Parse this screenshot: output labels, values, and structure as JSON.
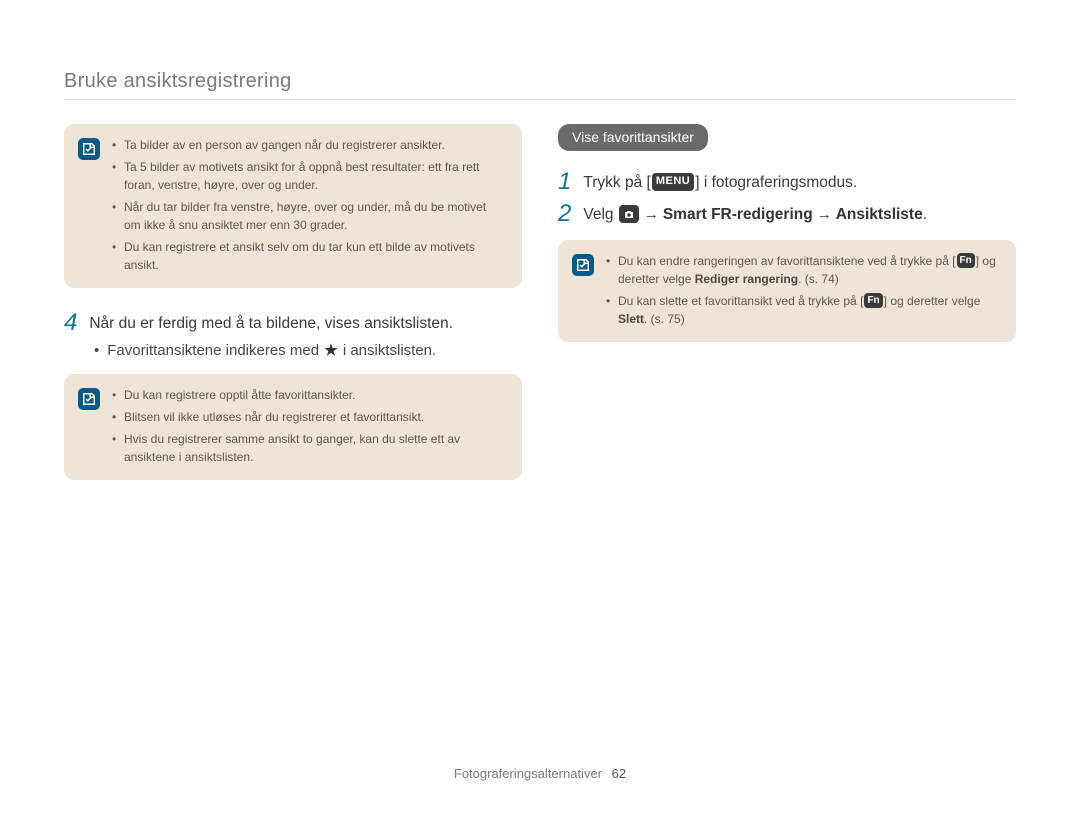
{
  "header": {
    "title": "Bruke ansiktsregistrering"
  },
  "left": {
    "info1": {
      "items": [
        "Ta bilder av en person av gangen når du registrerer ansikter.",
        "Ta 5 bilder av motivets ansikt for å oppnå best resultater: ett fra rett foran, venstre, høyre, over og under.",
        "Når du tar bilder fra venstre, høyre, over og under, må du be motivet om ikke å snu ansiktet mer enn 30 grader.",
        "Du kan registrere et ansikt selv om du tar kun ett bilde av motivets ansikt."
      ]
    },
    "step4": {
      "num": "4",
      "text": "Når du er ferdig med å ta bildene, vises ansiktslisten.",
      "sub_before": "Favorittansiktene indikeres med ",
      "sub_after": " i ansiktslisten."
    },
    "info2": {
      "items": [
        "Du kan registrere opptil åtte favorittansikter.",
        "Blitsen vil ikke utløses når du registrerer et favorittansikt.",
        "Hvis du registrerer samme ansikt to ganger, kan du slette ett av ansiktene i ansiktslisten."
      ]
    }
  },
  "right": {
    "pill": "Vise favorittansikter",
    "step1": {
      "num": "1",
      "before": "Trykk på [",
      "menu": "MENU",
      "after": "] i fotograferingsmodus."
    },
    "step2": {
      "num": "2",
      "before": "Velg ",
      "path1": "Smart FR-redigering",
      "path2": "Ansiktsliste"
    },
    "info3": {
      "item1_a": "Du kan endre rangeringen av favorittansiktene ved å trykke på [",
      "item1_b": "] og deretter velge ",
      "item1_bold": "Rediger rangering",
      "item1_c": ". (s. 74)",
      "item2_a": "Du kan slette et favorittansikt ved å trykke på [",
      "item2_b": "] og deretter velge ",
      "item2_bold": "Slett",
      "item2_c": ". (s. 75)",
      "fn": "Fn"
    }
  },
  "footer": {
    "section": "Fotograferingsalternativer",
    "page": "62"
  }
}
